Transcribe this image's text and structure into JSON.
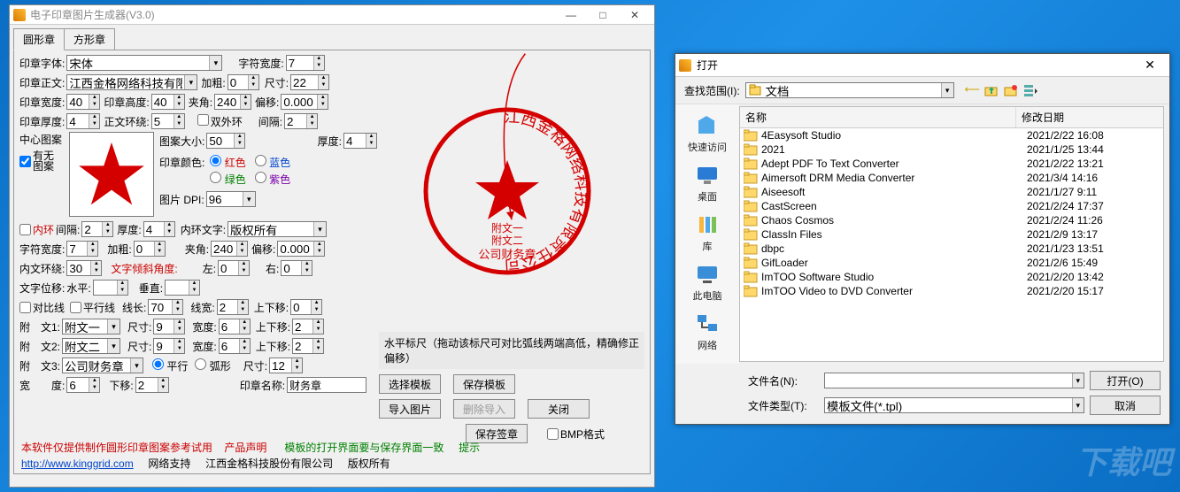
{
  "app": {
    "title": "电子印章图片生成器(V3.0)"
  },
  "tabs": {
    "round": "圆形章",
    "square": "方形章"
  },
  "labels": {
    "font": "印章字体:",
    "charw": "字符宽度:",
    "text": "印章正文:",
    "bold": "加粗:",
    "size": "尺寸:",
    "sw": "印章宽度:",
    "sh": "印章高度:",
    "angle": "夹角:",
    "offset": "偏移:",
    "thick": "印章厚度:",
    "wrap": "正文环绕:",
    "doublering": "双外环",
    "gap": "间隔:",
    "pattern": "中心图案",
    "haspat": "有无\n图案",
    "psize": "图案大小:",
    "pcolor": "印章颜色:",
    "c_red": "红色",
    "c_blue": "蓝色",
    "c_green": "绿色",
    "c_purple": "紫色",
    "dpi": "图片 DPI:",
    "innergap": "间隔:",
    "innerthick": "厚度:",
    "innerring": "内环",
    "innertext": "内环文字:",
    "charw2": "字符宽度:",
    "bold2": "加粗:",
    "angle2": "夹角:",
    "offset2": "偏移:",
    "innerwrap": "内文环绕:",
    "tilt": "文字倾斜角度:",
    "left": "左:",
    "right": "右:",
    "textoff": "文字位移:",
    "horiz": "水平:",
    "vert": "垂直:",
    "diag": "对比线",
    "parallel": "平行线",
    "linelen": "线长:",
    "linew": "线宽:",
    "ud": "上下移:",
    "att1": "附　文1:",
    "att2": "附　文2:",
    "att3": "附　文3:",
    "size_s": "尺寸:",
    "wide": "宽度:",
    "ud2": "上下移:",
    "layout_parallel": "平行",
    "layout_arc": "弧形",
    "width_l": "宽　　度:",
    "down": "下移:",
    "stampname": "印章名称:",
    "bmp": "BMP格式",
    "thick2": "厚度:"
  },
  "values": {
    "font": "宋体",
    "charw": "7",
    "text": "江西金格网络科技有限责",
    "bold": "0",
    "size": "22",
    "sw": "40",
    "sh": "40",
    "angle": "240",
    "offset": "0.000",
    "thick": "4",
    "wrap": "5",
    "gap": "2",
    "thick2": "4",
    "psize": "50",
    "dpi": "96",
    "innergap": "2",
    "innerthick": "4",
    "innertext": "版权所有",
    "charw2": "7",
    "bold2": "0",
    "angle2": "240",
    "offset2": "0.000",
    "innerwrap": "30",
    "left": "0",
    "right": "0",
    "h_off": "",
    "v_off": "",
    "linelen": "70",
    "linew": "2",
    "ud": "0",
    "att1": "附文一",
    "att1_s": "9",
    "att1_w": "6",
    "att1_ud": "2",
    "att2": "附文二",
    "att2_s": "9",
    "att2_w": "6",
    "att2_ud": "2",
    "att3": "公司财务章",
    "att3_sz": "12",
    "width_l": "6",
    "down": "2",
    "stampname": "财务章"
  },
  "ruler_note": "水平标尺（拖动该标尺可对比弧线两端高低，精确修正偏移）",
  "buttons": {
    "choose_tpl": "选择模板",
    "save_tpl": "保存模板",
    "import_img": "导入图片",
    "del_import": "删除导入",
    "close": "关闭",
    "save_sig": "保存签章"
  },
  "footer": {
    "l1a": "本软件仅提供制作圆形印章图案参考试用",
    "l1b": "产品声明",
    "l1c": "模板的打开界面要与保存界面一致",
    "l1d": "提示",
    "url": "http://www.kinggrid.com",
    "l2a": "网络支持",
    "l2b": "江西金格科技股份有限公司",
    "l2c": "版权所有"
  },
  "stamp_preview": {
    "outer_text": "江西金格网络科技有限责任公司",
    "line1": "附文一",
    "line2": "附文二",
    "line3": "公司财务章"
  },
  "open_dialog": {
    "title": "打开",
    "lookin_label": "查找范围(I):",
    "lookin_value": "文档",
    "columns": {
      "name": "名称",
      "date": "修改日期"
    },
    "places": {
      "quick": "快速访问",
      "desktop": "桌面",
      "lib": "库",
      "pc": "此电脑",
      "net": "网络"
    },
    "items": [
      {
        "name": "4Easysoft Studio",
        "date": "2021/2/22 16:08"
      },
      {
        "name": "2021",
        "date": "2021/1/25 13:44"
      },
      {
        "name": "Adept PDF To Text Converter",
        "date": "2021/2/22 13:21"
      },
      {
        "name": "Aimersoft DRM Media Converter",
        "date": "2021/3/4 14:16"
      },
      {
        "name": "Aiseesoft",
        "date": "2021/1/27 9:11"
      },
      {
        "name": "CastScreen",
        "date": "2021/2/24 17:37"
      },
      {
        "name": "Chaos Cosmos",
        "date": "2021/2/24 11:26"
      },
      {
        "name": "ClassIn Files",
        "date": "2021/2/9 13:17"
      },
      {
        "name": "dbpc",
        "date": "2021/1/23 13:51"
      },
      {
        "name": "GifLoader",
        "date": "2021/2/6 15:49"
      },
      {
        "name": "ImTOO Software Studio",
        "date": "2021/2/20 13:42"
      },
      {
        "name": "ImTOO Video to DVD Converter",
        "date": "2021/2/20 15:17"
      }
    ],
    "filename_label": "文件名(N):",
    "filetype_label": "文件类型(T):",
    "filetype_value": "模板文件(*.tpl)",
    "open_btn": "打开(O)",
    "cancel_btn": "取消"
  },
  "watermark": "下载吧"
}
